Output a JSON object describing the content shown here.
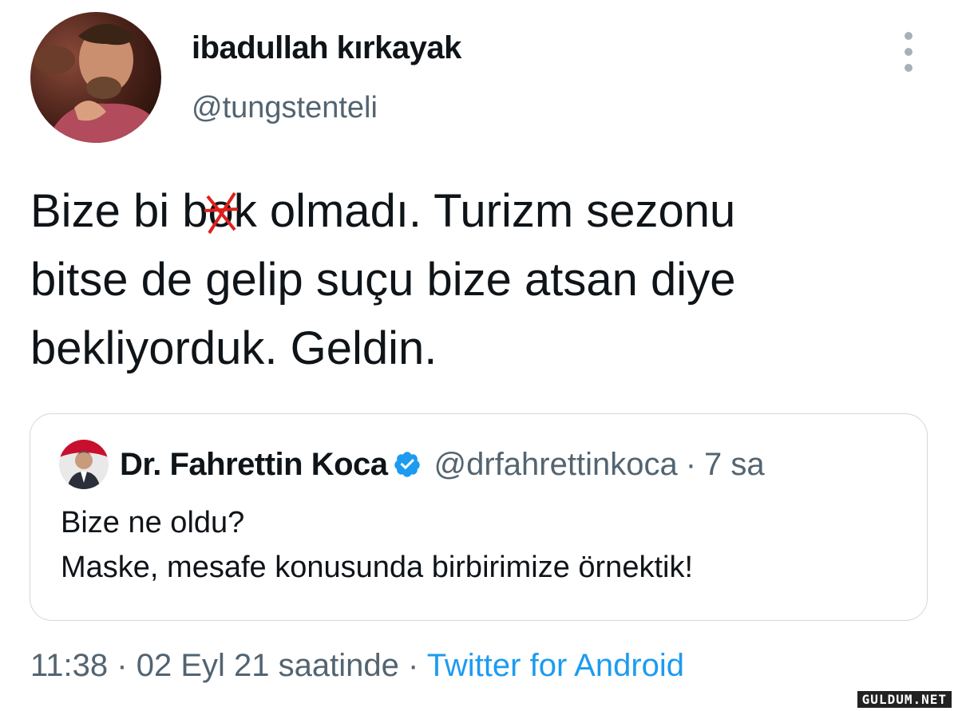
{
  "tweet": {
    "author": {
      "name": "ibadullah kırkayak",
      "handle": "@tungstenteli",
      "avatar_icon": "user-avatar-photo"
    },
    "more_icon": "more-vertical-icon",
    "text_lines": {
      "l1_pre": "Bize bi b",
      "l1_censored": "o",
      "l1_post": "k olmadı. Turizm sezonu",
      "l2": "bitse de gelip suçu bize atsan diye",
      "l3": "bekliyorduk. Geldin."
    },
    "censor_mark_color": "#e0201b",
    "quoted": {
      "author_name": "Dr. Fahrettin Koca",
      "verified_icon": "verified-badge-icon",
      "handle": "@drfahrettinkoca",
      "separator": "·",
      "time": "7 sa",
      "line1": "Bize ne oldu?",
      "line2": "Maske, mesafe konusunda birbirimize örnektik!"
    },
    "meta": {
      "time": "11:38",
      "sep1": "·",
      "date": "02 Eyl 21 saatinde",
      "sep2": "·",
      "source": "Twitter for Android"
    }
  },
  "watermark": "GULDUM.NET",
  "colors": {
    "text": "#0f1419",
    "secondary": "#536471",
    "link": "#1d9bf0",
    "verified": "#1d9bf0",
    "border": "#cfd9de"
  }
}
